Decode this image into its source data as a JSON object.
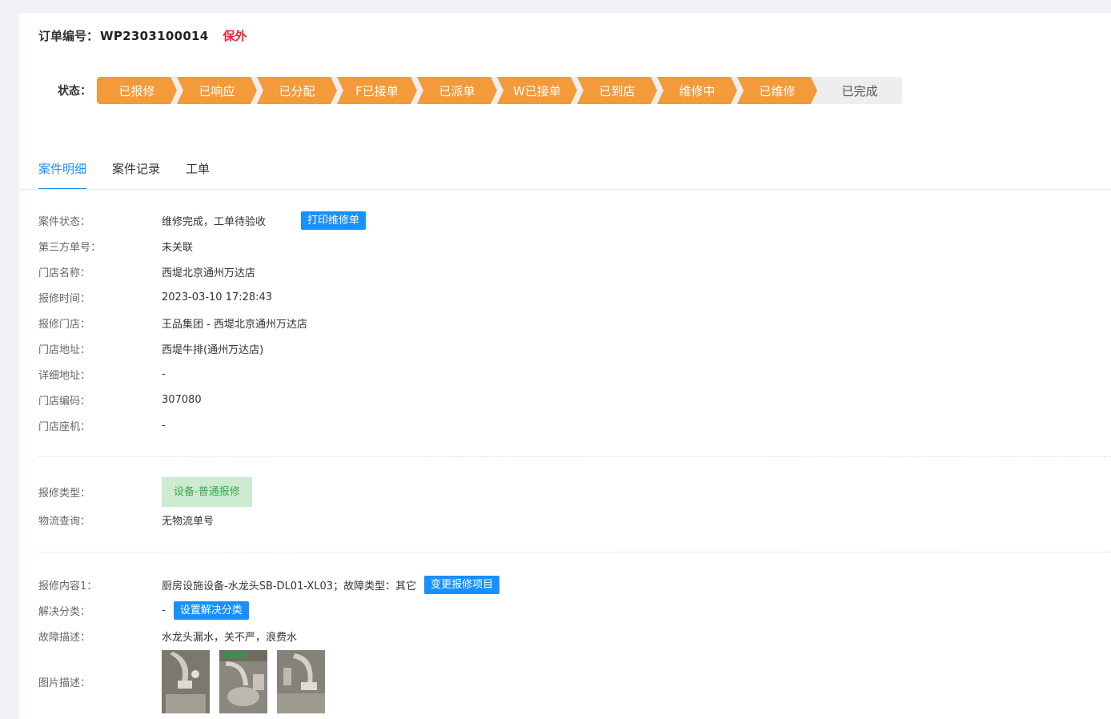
{
  "order": {
    "label": "订单编号：",
    "number": "WP2303100014",
    "warranty_tag": "保外"
  },
  "status": {
    "label": "状态：",
    "steps": [
      {
        "label": "已报修",
        "done": true
      },
      {
        "label": "已响应",
        "done": true
      },
      {
        "label": "已分配",
        "done": true
      },
      {
        "label": "F已接单",
        "done": true
      },
      {
        "label": "已派单",
        "done": true
      },
      {
        "label": "W已接单",
        "done": true
      },
      {
        "label": "已到店",
        "done": true
      },
      {
        "label": "维修中",
        "done": true
      },
      {
        "label": "已维修",
        "done": true
      },
      {
        "label": "已完成",
        "done": false
      }
    ],
    "colors": {
      "done": "#f39a39",
      "pending": "#eeeeee"
    }
  },
  "tabs": [
    {
      "label": "案件明细",
      "active": true
    },
    {
      "label": "案件记录",
      "active": false
    },
    {
      "label": "工单",
      "active": false
    }
  ],
  "details": {
    "case_status": {
      "key": "案件状态：",
      "value": "维修完成，工单待验收",
      "button": "打印维修单"
    },
    "third_party_no": {
      "key": "第三方单号：",
      "value": "未关联"
    },
    "store_name": {
      "key": "门店名称：",
      "value": "西堤北京通州万达店"
    },
    "report_time": {
      "key": "报修时间：",
      "value": "2023-03-10 17:28:43"
    },
    "report_store": {
      "key": "报修门店：",
      "value": "王品集团 - 西堤北京通州万达店"
    },
    "store_address": {
      "key": "门店地址：",
      "value": "西堤牛排(通州万达店)"
    },
    "detail_address": {
      "key": "详细地址：",
      "value": "-"
    },
    "store_code": {
      "key": "门店编码：",
      "value": "307080"
    },
    "store_phone": {
      "key": "门店座机：",
      "value": "-"
    }
  },
  "repair_info": {
    "repair_type": {
      "key": "报修类型：",
      "value": "设备-普通报修"
    },
    "logistics": {
      "key": "物流查询：",
      "value": "无物流单号"
    }
  },
  "repair_content": {
    "content1": {
      "key": "报修内容1：",
      "value": "厨房设施设备-水龙头SB-DL01-XL03；故障类型：其它",
      "button": "变更报修项目"
    },
    "solution": {
      "key": "解决分类：",
      "value": "-",
      "button": "设置解决分类"
    },
    "fault_desc": {
      "key": "故障描述：",
      "value": "水龙头漏水，关不严，浪费水"
    },
    "images": {
      "key": "图片描述：",
      "count": 3
    }
  },
  "colors": {
    "accent": "#1890ff",
    "warn": "#f5222d",
    "green_tag_bg": "#cdebd1",
    "green_tag_text": "#3aa54a"
  }
}
